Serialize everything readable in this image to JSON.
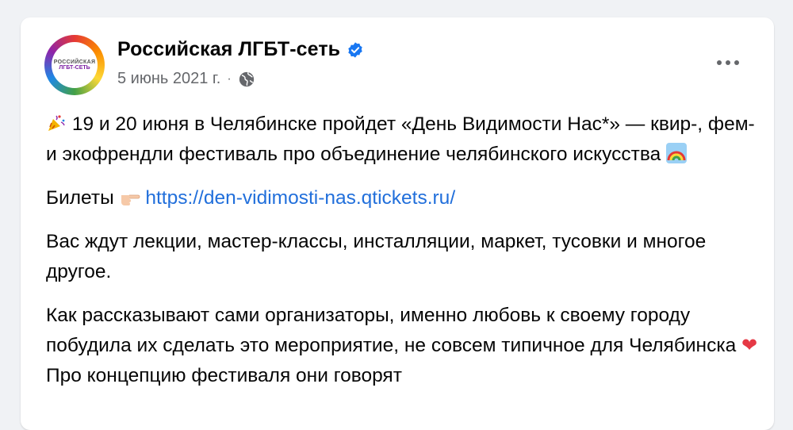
{
  "post": {
    "author": {
      "name": "Российская ЛГБТ-сеть",
      "verified_icon": "verified-badge-icon",
      "avatar_line1": "РОССИЙСКАЯ",
      "avatar_line2": "ЛГБТ-СЕТЬ"
    },
    "meta": {
      "date": "5 июнь 2021 г.",
      "separator": "·",
      "audience_icon": "globe-icon"
    },
    "more_icon": "more-options-icon",
    "paragraphs": {
      "p1_text": "19 и 20 июня в Челябинске пройдет «День Видимости Нас*» — квир-, фем- и экофрендли фестиваль про объединение челябинского искусства",
      "p2_prefix": "Билеты",
      "p2_link": "https://den-vidimosti-nas.qtickets.ru/",
      "p3_text": "Вас ждут лекции, мастер-классы, инсталляции, маркет, тусовки и многое другое.",
      "p4_text": "Как рассказывают сами организаторы, именно любовь к своему городу побудила их сделать это мероприятие, не совсем типичное для Челябинска",
      "p4_suffix": "Про концепцию фестиваля они говорят"
    }
  },
  "colors": {
    "background": "#f0f2f5",
    "card": "#ffffff",
    "text": "#050505",
    "secondary_text": "#65676b",
    "link": "#216fdb",
    "verified": "#1877f2",
    "heart": "#e53945"
  }
}
